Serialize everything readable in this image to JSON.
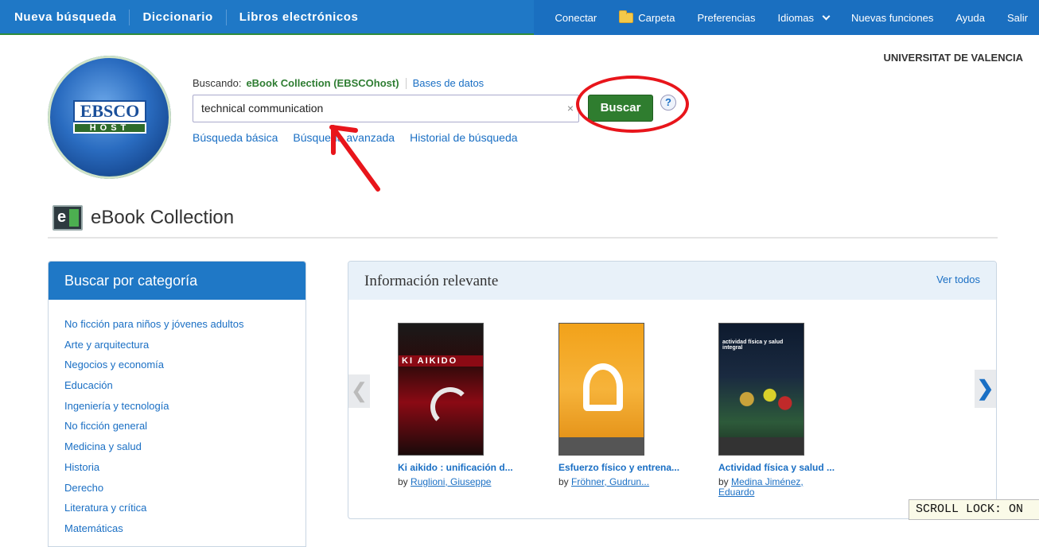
{
  "topbar": {
    "left_nav": [
      "Nueva búsqueda",
      "Diccionario",
      "Libros electrónicos"
    ],
    "conectar": "Conectar",
    "carpeta": "Carpeta",
    "preferencias": "Preferencias",
    "idiomas": "Idiomas",
    "nuevas_funciones": "Nuevas funciones",
    "ayuda": "Ayuda",
    "salir": "Salir"
  },
  "institution": "UNIVERSITAT DE VALENCIA",
  "logo": {
    "text_top": "EBSCO",
    "text_bottom": "HOST"
  },
  "search": {
    "searching_label": "Buscando:",
    "collection": "eBook Collection (EBSCOhost)",
    "databases_link": "Bases de datos",
    "query": "technical communication",
    "clear": "×",
    "button": "Buscar",
    "help": "?",
    "links": [
      "Búsqueda básica",
      "Búsqueda avanzada",
      "Historial de búsqueda"
    ]
  },
  "collection_title": "eBook Collection",
  "category_panel": {
    "title": "Buscar por categoría",
    "items": [
      "No ficción para niños y jóvenes adultos",
      "Arte y arquitectura",
      "Negocios y economía",
      "Educación",
      "Ingeniería y tecnología",
      "No ficción general",
      "Medicina y salud",
      "Historia",
      "Derecho",
      "Literatura y crítica",
      "Matemáticas"
    ]
  },
  "relevant_panel": {
    "title": "Información relevante",
    "see_all": "Ver todos",
    "prev": "❮",
    "next": "❯",
    "books": [
      {
        "title": "Ki aikido : unificación d...",
        "by": "by",
        "author": "Ruglioni, Giuseppe",
        "cover_text": "KI AIKIDO"
      },
      {
        "title": "Esfuerzo físico y entrena...",
        "by": "by",
        "author": "Fröhner, Gudrun..."
      },
      {
        "title": "Actividad física y salud ...",
        "by": "by",
        "author": "Medina Jiménez, Eduardo",
        "cover_text": "actividad física y salud integral"
      }
    ]
  },
  "status": {
    "scroll_lock": "SCROLL LOCK: ON"
  },
  "colors": {
    "brand_blue": "#1f78c6",
    "search_green": "#2f7d2f",
    "annotation_red": "#e8151b"
  }
}
